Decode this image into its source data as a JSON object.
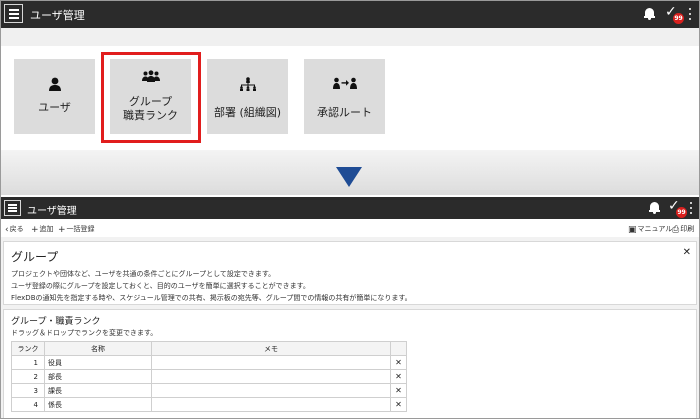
{
  "app": {
    "title": "ユーザ管理",
    "approval_badge": "99"
  },
  "tiles": [
    {
      "label": "ユーザ",
      "icon": "user-icon"
    },
    {
      "label": "グループ\n職責ランク",
      "icon": "group-icon"
    },
    {
      "label": "部署 (組織図)",
      "icon": "org-chart-icon"
    },
    {
      "label": "承認ルート",
      "icon": "approval-route-icon"
    }
  ],
  "toolbar": {
    "back": "戻る",
    "add": "追加",
    "bulk_register": "一括登録",
    "manual": "マニュアル",
    "print": "印刷"
  },
  "group_card": {
    "title": "グループ",
    "lines": [
      "プロジェクトや団体など、ユーザを共通の条件ごとにグループとして設定できます。",
      "ユーザ登録の際にグループを設定しておくと、目的のユーザを簡単に選択することができます。",
      "FlexDBの通知先を指定する時や、スケジュール管理での共有、掲示板の宛先等、グループ間での情報の共有が簡単になります。"
    ]
  },
  "rank_card": {
    "title": "グループ・職責ランク",
    "instruction": "ドラッグ＆ドロップでランクを変更できます。",
    "columns": [
      "ランク",
      "名称",
      "メモ"
    ],
    "rows": [
      {
        "rank": "1",
        "name": "役員",
        "memo": ""
      },
      {
        "rank": "2",
        "name": "部長",
        "memo": ""
      },
      {
        "rank": "3",
        "name": "課長",
        "memo": ""
      },
      {
        "rank": "4",
        "name": "係長",
        "memo": ""
      }
    ]
  },
  "colors": {
    "appbar": "#2b2b2b",
    "tile": "#dcdcdc",
    "highlight": "#e11d1d",
    "arrow": "#1f4c95",
    "badge": "#d9201e"
  }
}
